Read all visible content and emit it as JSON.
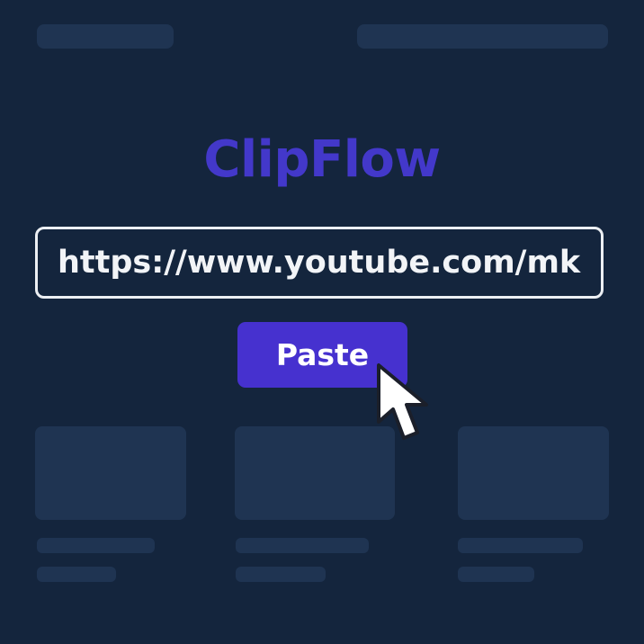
{
  "app": {
    "title": "ClipFlow"
  },
  "url_input": {
    "value": "https://www.youtube.com/mk"
  },
  "paste_button": {
    "label": "Paste"
  },
  "icons": {
    "pointer": "arrow-cursor-icon"
  },
  "colors": {
    "background": "#14253d",
    "placeholder": "#1f3452",
    "brand": "#4338ca",
    "button": "#4631cf",
    "input_border": "#eceff3",
    "text": "#f2f4f7"
  }
}
